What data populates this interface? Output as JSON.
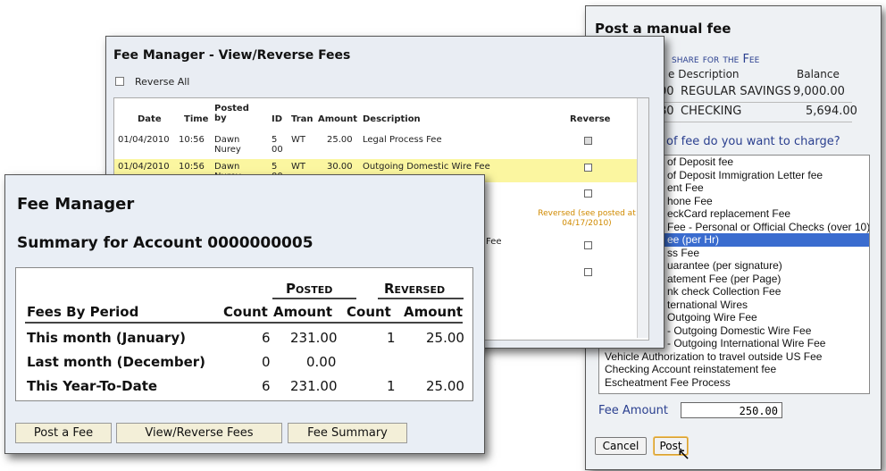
{
  "post_fee": {
    "title": "Post a manual fee",
    "share_heading": "share for the Fee",
    "col_desc": "e  Description",
    "col_balance": "Balance",
    "accounts": [
      {
        "id": "00",
        "desc": "REGULAR SAVINGS",
        "balance": "9,000.00"
      },
      {
        "id": "80",
        "desc": "CHECKING",
        "balance": "5,694.00"
      }
    ],
    "question": "of fee do you want to charge?",
    "fee_types": [
      "of Deposit fee",
      "of Deposit Immigration Letter fee",
      "ent Fee",
      "hone Fee",
      "eckCard replacement Fee",
      "Fee - Personal or Official Checks (over 10)",
      "ee (per Hr)",
      "ss Fee",
      "uarantee (per signature)",
      "atement Fee (per Page)",
      "nk check Collection Fee",
      "ternational Wires",
      "Outgoing Wire Fee",
      "- Outgoing Domestic Wire Fee",
      "- Outgoing International Wire Fee",
      "Vehicle Authorization to travel outside US Fee",
      "Checking Account reinstatement fee",
      "Escheatment Fee Process"
    ],
    "selected_index": 6,
    "fee_amount_label": "Fee Amount",
    "fee_amount_value": "250.00",
    "cancel_label": "Cancel",
    "post_label": "Post"
  },
  "view_reverse": {
    "title": "Fee Manager - View/Reverse Fees",
    "reverse_all_label": "Reverse All",
    "headers": {
      "date": "Date",
      "time": "Time",
      "posted_by": "Posted by",
      "id": "ID",
      "tran": "Tran",
      "amount": "Amount",
      "description": "Description",
      "reverse": "Reverse"
    },
    "rows": [
      {
        "date": "01/04/2010",
        "time": "10:56",
        "posted_by": "Dawn Nurey",
        "id": "5 00",
        "tran": "WT",
        "amount": "25.00",
        "description": "Legal Process Fee"
      },
      {
        "date": "01/04/2010",
        "time": "10:56",
        "posted_by": "Dawn Nurey",
        "id": "5 00",
        "tran": "WT",
        "amount": "30.00",
        "description": "Outgoing Domestic Wire Fee"
      }
    ],
    "note": "Reversed (see posted at 04/17/2010)",
    "row5_desc": "Fee"
  },
  "summary": {
    "title": "Fee Manager",
    "subtitle": "Summary for Account 0000000005",
    "group_posted": "Posted",
    "group_reversed": "Reversed",
    "col_period": "Fees By Period",
    "col_count": "Count",
    "col_amount": "Amount",
    "rows": [
      {
        "period": "This month (January)",
        "posted_count": "6",
        "posted_amount": "231.00",
        "reversed_count": "1",
        "reversed_amount": "25.00"
      },
      {
        "period": "Last month (December)",
        "posted_count": "0",
        "posted_amount": "0.00",
        "reversed_count": "",
        "reversed_amount": ""
      },
      {
        "period": "This Year-To-Date",
        "posted_count": "6",
        "posted_amount": "231.00",
        "reversed_count": "1",
        "reversed_amount": "25.00"
      }
    ],
    "buttons": {
      "post_fee": "Post a Fee",
      "view_reverse": "View/Reverse Fees",
      "fee_summary": "Fee Summary"
    }
  }
}
